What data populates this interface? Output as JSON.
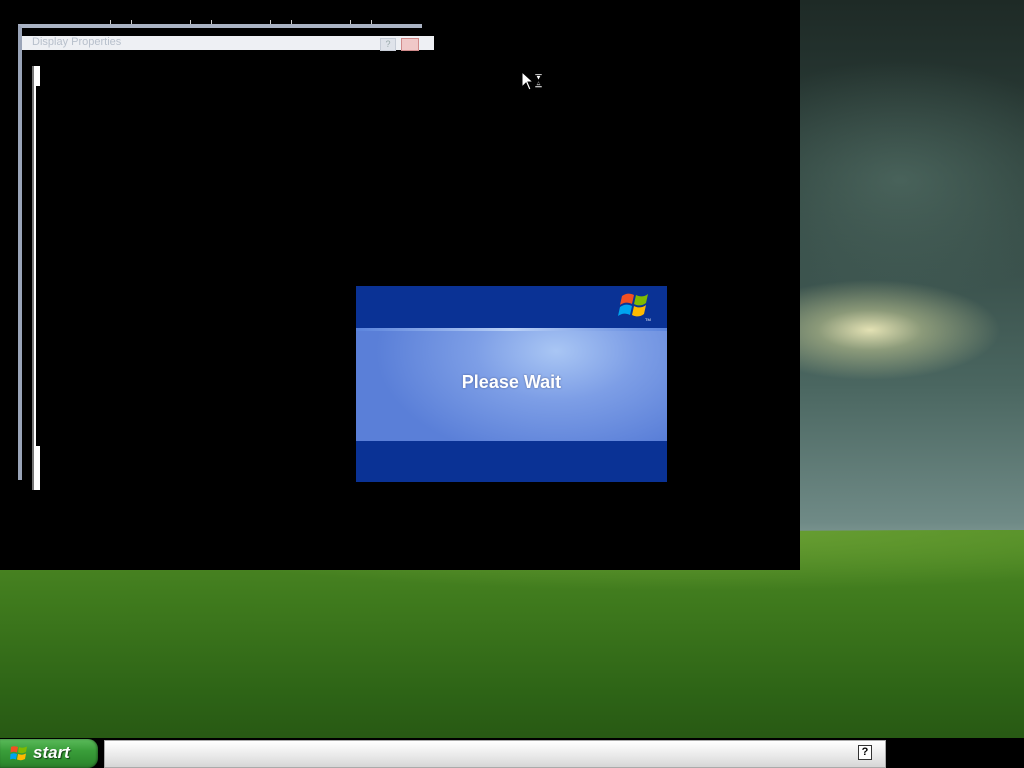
{
  "dialog": {
    "message": "Please Wait",
    "logo": "windows-logo-icon"
  },
  "ghost_window": {
    "title": "Display Properties",
    "help_label": "?"
  },
  "taskbar": {
    "start_label": "start",
    "tray_icon": "help-icon",
    "tray_label": "?"
  },
  "cursor": "busy-arrow-cursor-icon",
  "colors": {
    "dialog_band": "#0a3295",
    "dialog_body": "#7d9ee6",
    "start_green": "#3a9e3a",
    "black_region": "#000000"
  }
}
